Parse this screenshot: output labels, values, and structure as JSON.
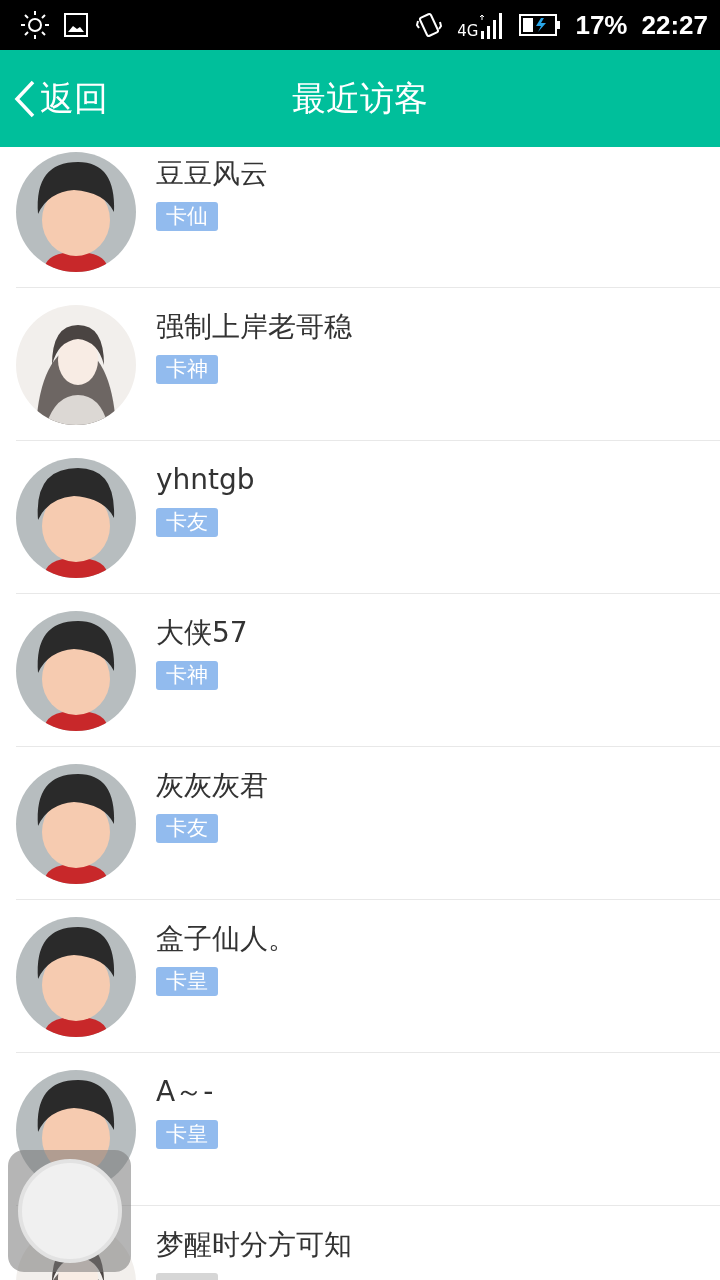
{
  "status_bar": {
    "network": "4G",
    "battery": "17%",
    "time": "22:27"
  },
  "header": {
    "back": "返回",
    "title": "最近访客"
  },
  "visitors": [
    {
      "name": "豆豆风云",
      "kind": "default",
      "tag": {
        "text": "卡仙",
        "color": "#92bbee"
      }
    },
    {
      "name": "强制上岸老哥稳",
      "kind": "illustration",
      "tag": {
        "text": "卡神",
        "color": "#92bbee"
      }
    },
    {
      "name": "yhntgb",
      "kind": "default",
      "tag": {
        "text": "卡友",
        "color": "#92bbee"
      }
    },
    {
      "name": "大侠57",
      "kind": "default",
      "tag": {
        "text": "卡神",
        "color": "#92bbee"
      }
    },
    {
      "name": "灰灰灰君",
      "kind": "default",
      "tag": {
        "text": "卡友",
        "color": "#92bbee"
      }
    },
    {
      "name": "盒子仙人。",
      "kind": "default",
      "tag": {
        "text": "卡皇",
        "color": "#92bbee"
      }
    },
    {
      "name": "A～-",
      "kind": "default",
      "tag": {
        "text": "卡皇",
        "color": "#92bbee"
      }
    },
    {
      "name": "梦醒时分方可知",
      "kind": "illustration",
      "tag": {
        "color": "#d6d6d6"
      }
    }
  ],
  "floating_button": {
    "kind": "assistive"
  }
}
